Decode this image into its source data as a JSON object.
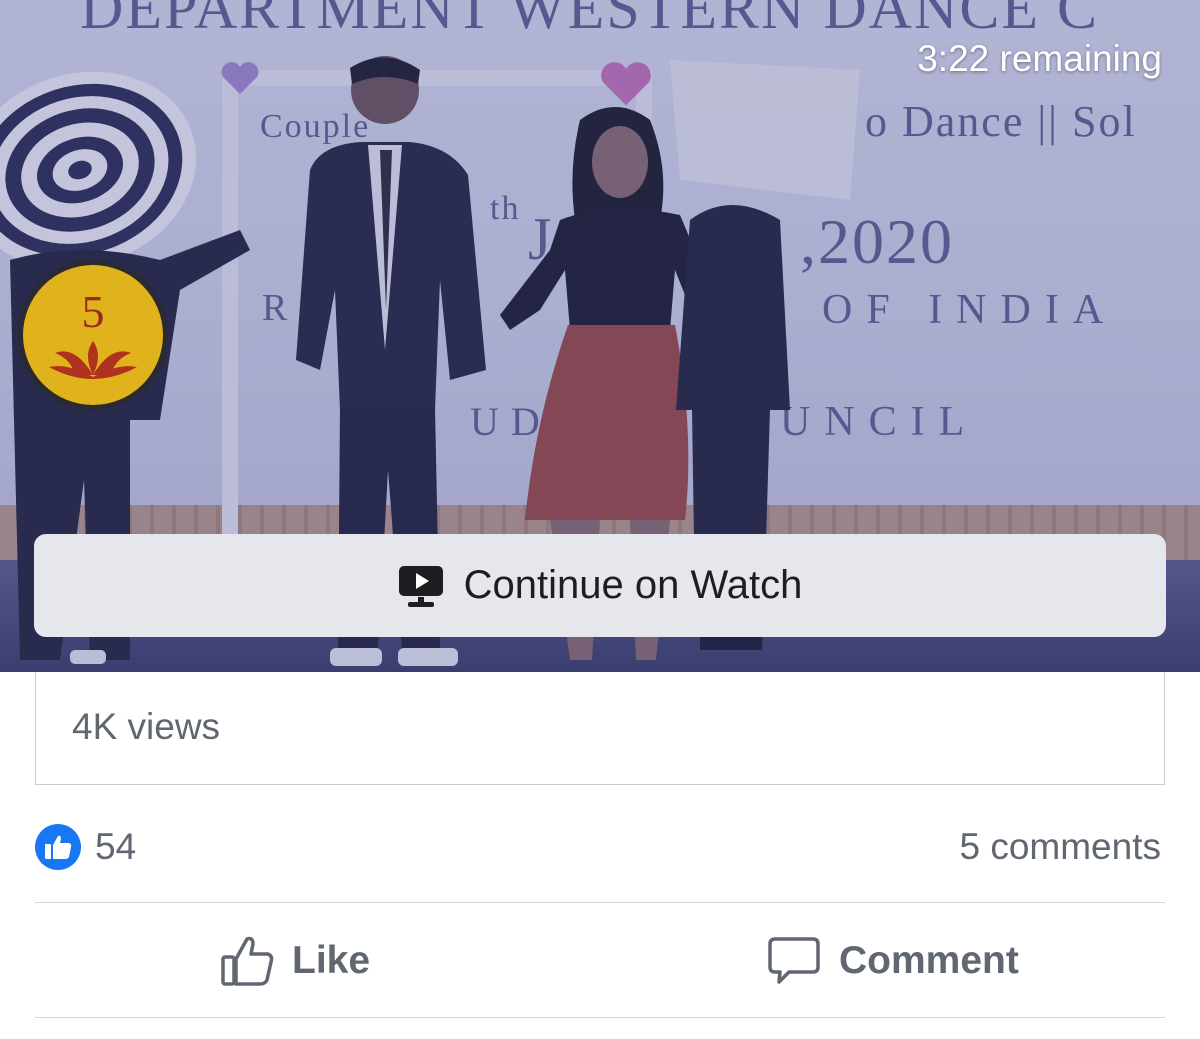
{
  "video": {
    "remaining": "3:22 remaining",
    "continue_label": "Continue on Watch",
    "banner": {
      "line1": "DEPARTMENT WESTERN DANCE C",
      "line2a": "Couple",
      "line2b": "o Dance || Sol",
      "line3a": "th",
      "line3b": "J",
      "line3c": ",2020",
      "line4a": "R",
      "line4b": "OF INDIA",
      "line5a": "UD",
      "line5b": "UNCIL"
    },
    "badge_text": "5"
  },
  "stats": {
    "views": "4K views",
    "likes": "54",
    "comments": "5 comments"
  },
  "actions": {
    "like_label": "Like",
    "comment_label": "Comment"
  },
  "colors": {
    "like_blue": "#1877f2",
    "text_gray": "#606770",
    "button_bg": "#e6e7ec"
  }
}
